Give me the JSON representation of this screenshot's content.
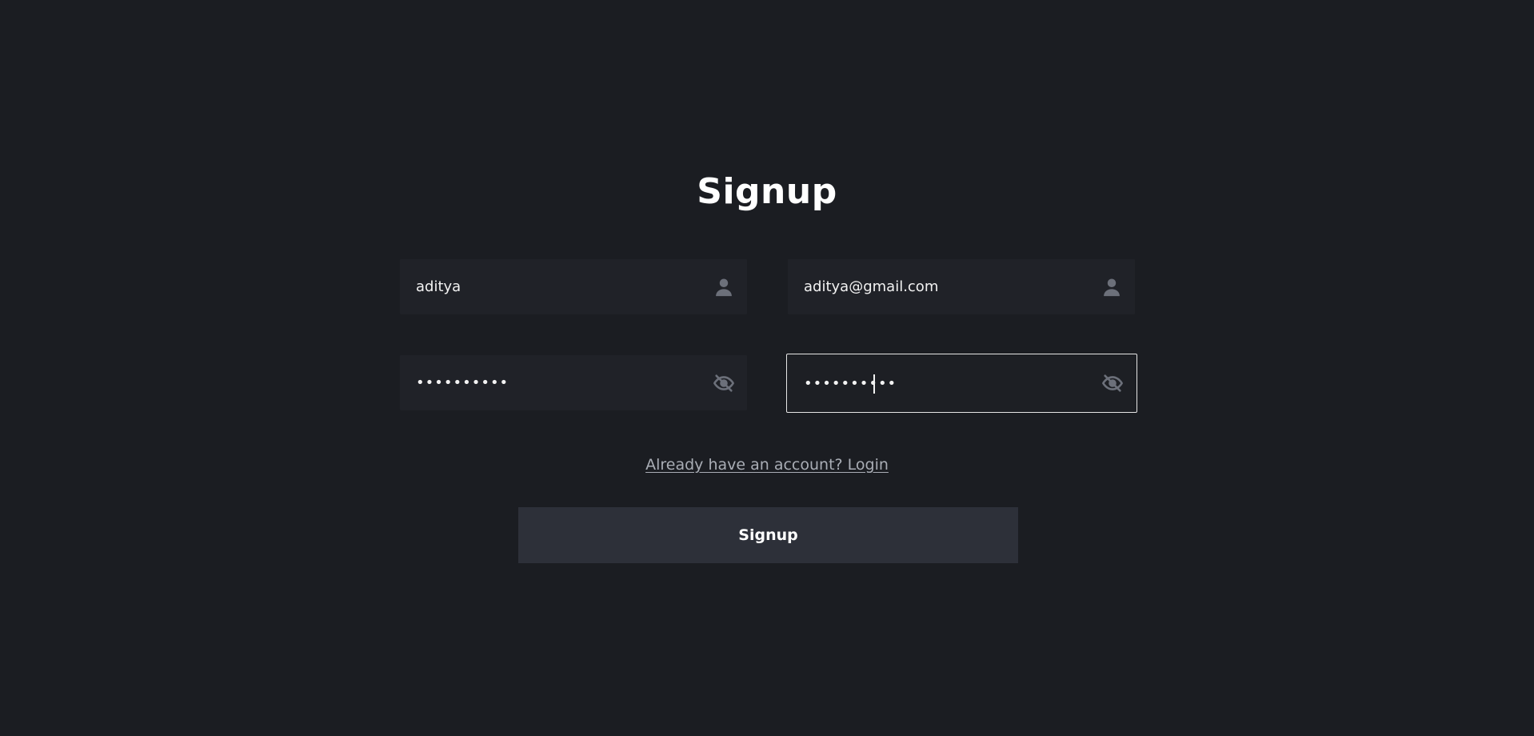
{
  "page": {
    "title": "Signup"
  },
  "form": {
    "username": {
      "value": "aditya",
      "icon": "user-icon"
    },
    "email": {
      "value": "aditya@gmail.com",
      "icon": "user-icon"
    },
    "password": {
      "value": "••••••••••",
      "icon": "eye-slash-icon"
    },
    "confirm_password": {
      "value": "••••••••••",
      "icon": "eye-slash-icon",
      "focused": true
    }
  },
  "login_link": {
    "label": "Already have an account? Login"
  },
  "submit": {
    "label": "Signup"
  },
  "colors": {
    "background": "#1b1d22",
    "field_background": "#202228",
    "button_background": "#2d3039",
    "focus_border": "#e6e6e6",
    "link": "#a9adb5",
    "icon": "#6c707a"
  }
}
